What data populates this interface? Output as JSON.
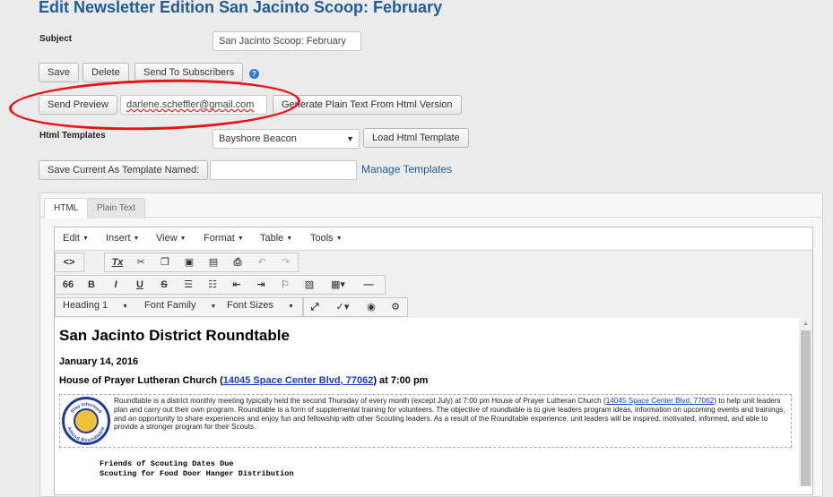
{
  "page": {
    "title": "Edit Newsletter Edition San Jacinto Scoop: February"
  },
  "form": {
    "subject_label": "Subject",
    "subject_value": "San Jacinto Scoop: February",
    "save": "Save",
    "delete": "Delete",
    "send_to_subscribers": "Send To Subscribers",
    "help_glyph": "?",
    "send_preview": "Send Preview",
    "preview_email": "darlene.scheffler@gmail.com",
    "generate_plain_text": "Generate Plain Text From Html Version",
    "html_templates_label": "Html Templates",
    "template_selected": "Bayshore Beacon",
    "load_template": "Load Html Template",
    "save_as_template": "Save Current As Template Named:",
    "template_name_value": "",
    "manage_templates": "Manage Templates"
  },
  "tabs": {
    "html": "HTML",
    "plain": "Plain Text"
  },
  "editor": {
    "menus": [
      "Edit",
      "Insert",
      "View",
      "Format",
      "Table",
      "Tools"
    ],
    "toolbar": {
      "source": "<>",
      "clear": "Tx",
      "blockquote": "66",
      "bold": "B",
      "italic": "I",
      "underline": "U",
      "strike": "S",
      "heading": "Heading 1",
      "font_family": "Font Family",
      "font_sizes": "Font Sizes"
    }
  },
  "document": {
    "heading": "San Jacinto District Roundtable",
    "date": "January 14, 2016",
    "location_prefix": "House of Prayer Lutheran Church (",
    "location_link": "14045 Space Center Blvd, 77062",
    "location_suffix": ") at 7:00 pm",
    "para_part1": "Roundtable is a district monthly meeting typically held the second Thursday of every month (except July) at 7:00 pm House of Prayer Lutheran Church (",
    "para_link": "14045 Space Center Blvd, 77062",
    "para_part2": ") to help unit leaders plan and carry out their own program. Roundtable is a form of supplemental training for volunteers. The objective of roundtable is to give leaders program ideas, information on upcoming events and trainings, and an opportunity to share experiences and enjoy fun and fellowship with other Scouting leaders. As a result of the Roundtable experience, unit leaders will be inspired, motivated, informed, and able to provide a stronger program for their Scouts.",
    "logo_text_top": "Stay Informed",
    "logo_text_bottom": "Attend Roundtable",
    "item1": "Friends of Scouting Dates Due",
    "item2": "Scouting for Food Door Hanger Distribution"
  }
}
